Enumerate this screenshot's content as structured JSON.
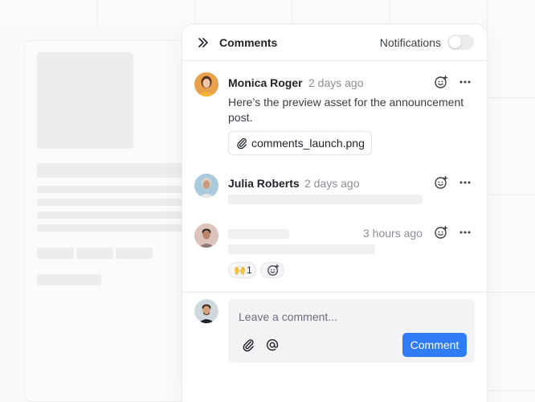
{
  "header": {
    "title": "Comments",
    "notifications_label": "Notifications",
    "notifications_on": false
  },
  "comments": [
    {
      "author": "Monica Roger",
      "time": "2 days ago",
      "text": "Here’s the preview asset for the announcement post.",
      "attachment": "comments_launch.png",
      "avatar_color": "#e0913a"
    },
    {
      "author": "Julia Roberts",
      "time": "2 days ago",
      "avatar_color": "#a9c9dc"
    },
    {
      "author": "",
      "time": "3 hours ago",
      "avatar_color": "#c9a59a",
      "reaction": {
        "emoji": "🙌",
        "count": "1"
      }
    }
  ],
  "composer": {
    "placeholder": "Leave a comment...",
    "submit_label": "Comment"
  },
  "colors": {
    "accent": "#2f7cf6",
    "panel_bg": "#ffffff",
    "border": "#ececef"
  }
}
